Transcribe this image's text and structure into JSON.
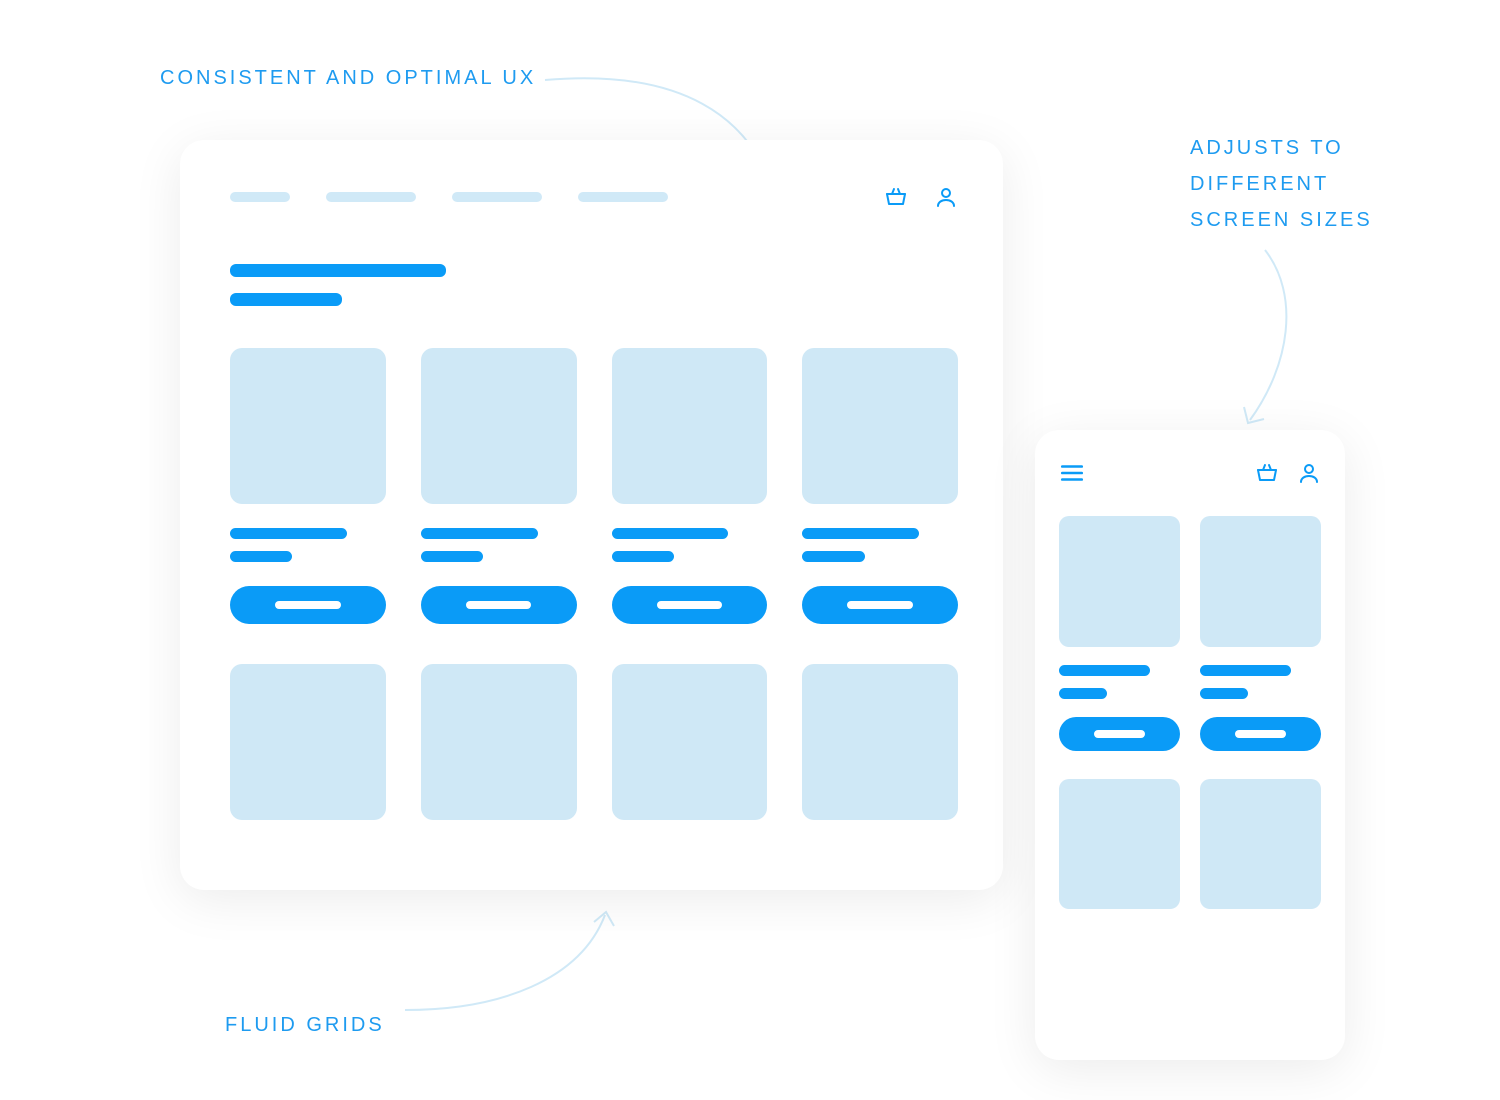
{
  "labels": {
    "top": "CONSISTENT AND OPTIMAL UX",
    "right": "ADJUSTS TO\nDIFFERENT\nSCREEN SIZES",
    "bottom": "FLUID GRIDS"
  },
  "nav": {
    "link_widths": [
      60,
      90,
      90,
      90
    ],
    "icons": [
      "basket",
      "user"
    ]
  },
  "mobile": {
    "menu_icon": "menu",
    "icons": [
      "basket",
      "user"
    ]
  },
  "colors": {
    "accent": "#0a9bf7",
    "pale": "#d0e9f7"
  },
  "desktop_cards": {
    "full": 4,
    "partial": 4
  },
  "mobile_cards": {
    "full": 2,
    "partial": 2
  }
}
